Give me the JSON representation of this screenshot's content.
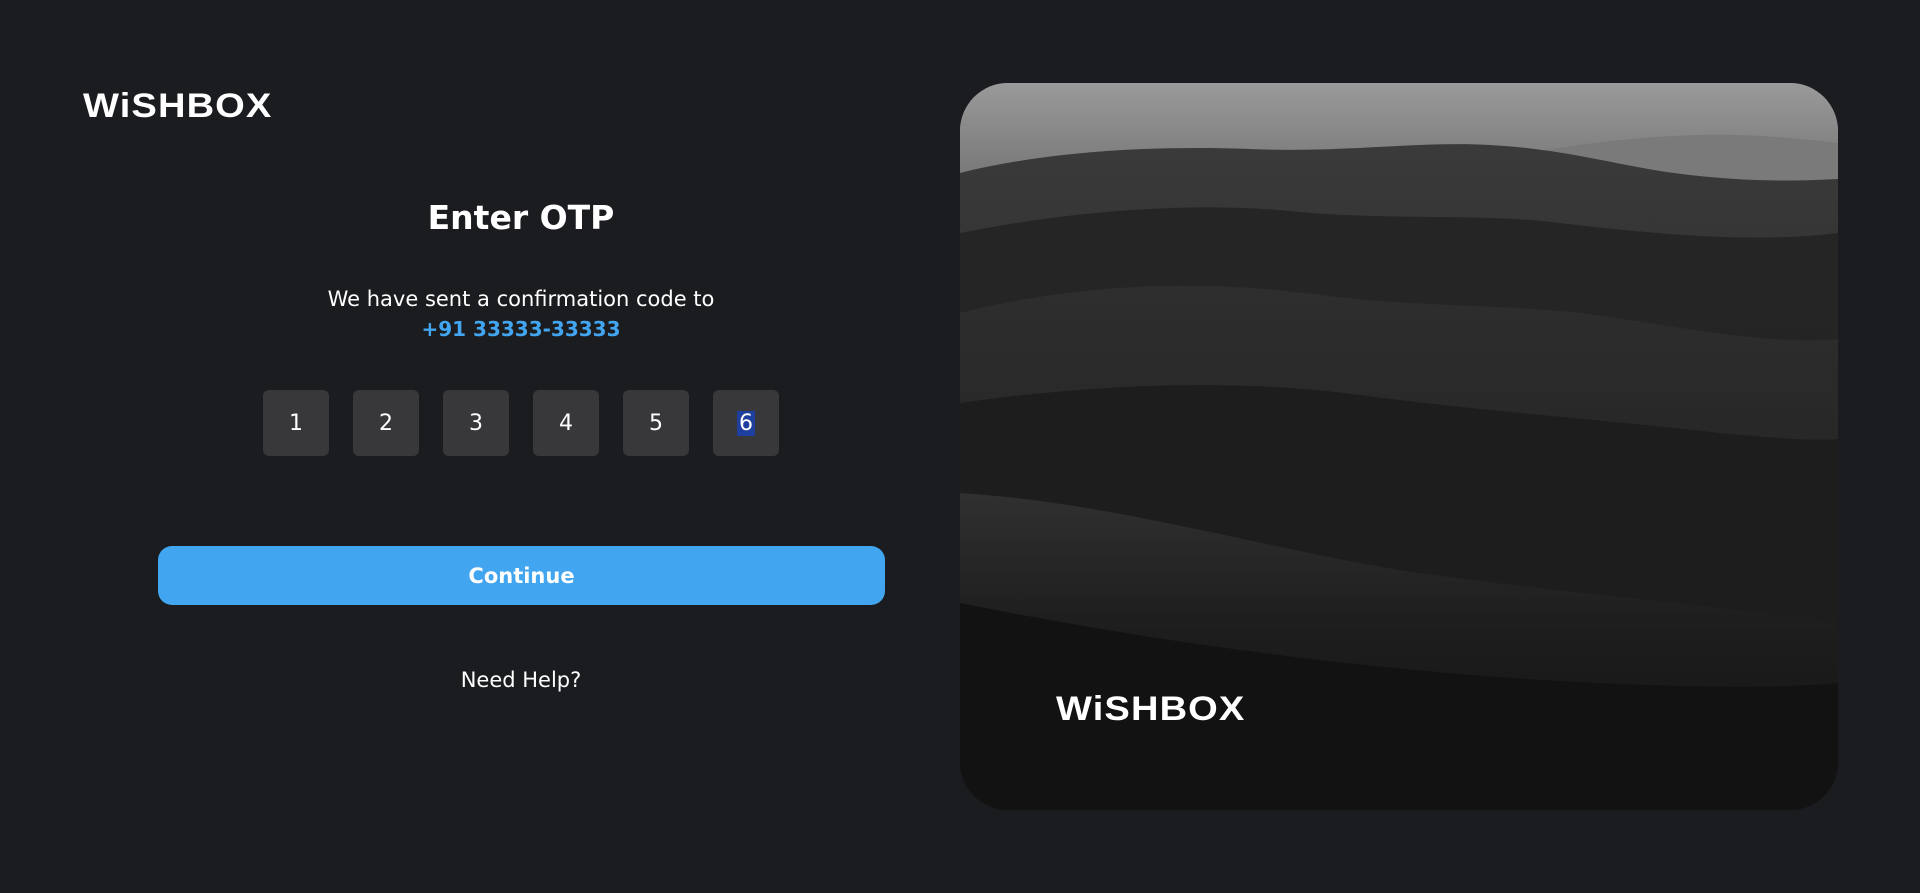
{
  "brand": {
    "logo_text": "WiSHBOX"
  },
  "otp": {
    "title": "Enter OTP",
    "subtitle": "We have sent a confirmation code to",
    "phone": "+91 33333-33333",
    "digits": [
      "1",
      "2",
      "3",
      "4",
      "5",
      "6"
    ],
    "active_index": 5
  },
  "actions": {
    "continue_label": "Continue",
    "help_label": "Need Help?"
  },
  "hero": {
    "logo_text": "WiSHBOX"
  },
  "colors": {
    "background": "#1b1c20",
    "accent": "#42a5f0",
    "otp_box": "#38383b",
    "selection": "#1f3f9e"
  }
}
